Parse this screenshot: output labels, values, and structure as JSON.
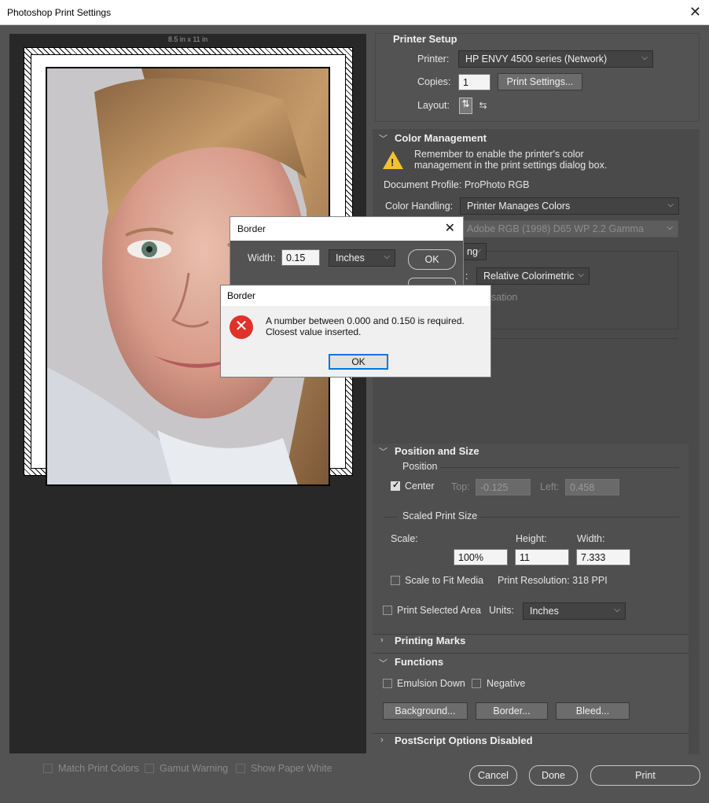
{
  "window": {
    "title": "Photoshop Print Settings",
    "close": "✕"
  },
  "preview": {
    "paper_size": "8.5 in x 11 in"
  },
  "printer_setup": {
    "header": "Printer Setup",
    "printer_label": "Printer:",
    "printer_value": "HP ENVY 4500 series (Network)",
    "copies_label": "Copies:",
    "copies_value": "1",
    "print_settings_button": "Print Settings...",
    "layout_label": "Layout:"
  },
  "color_management": {
    "header": "Color Management",
    "warning_text": "Remember to enable the printer's color management in the print settings dialog box.",
    "document_profile": "Document Profile: ProPhoto RGB",
    "color_handling_label": "Color Handling:",
    "color_handling_value": "Printer Manages Colors",
    "printer_profile_value": "Adobe RGB (1998) D65 WP 2.2 Gamma",
    "proofing_partial": "ng",
    "rendering_intent_partial": ":",
    "rendering_intent_value": "Relative Colorimetric",
    "bpc_partial": "sation"
  },
  "position_size": {
    "header": "Position and Size",
    "position_label": "Position",
    "center_label": "Center",
    "top_label": "Top:",
    "top_value": "-0.125",
    "left_label": "Left:",
    "left_value": "0.458",
    "scaled_label": "Scaled Print Size",
    "scale_label": "Scale:",
    "height_label": "Height:",
    "width_label": "Width:",
    "scale_value": "100%",
    "height_value": "11",
    "width_value": "7.333",
    "fit_media_label": "Scale to Fit Media",
    "print_resolution": "Print Resolution: 318 PPI",
    "print_selected_label": "Print Selected Area",
    "units_label": "Units:",
    "units_value": "Inches"
  },
  "printing_marks": {
    "header": "Printing Marks"
  },
  "functions": {
    "header": "Functions",
    "emulsion_label": "Emulsion Down",
    "negative_label": "Negative",
    "background_button": "Background...",
    "border_button": "Border...",
    "bleed_button": "Bleed..."
  },
  "postscript": {
    "header": "PostScript Options Disabled"
  },
  "bottom": {
    "match_print_colors": "Match Print Colors",
    "gamut_warning": "Gamut Warning",
    "show_paper_white": "Show Paper White",
    "cancel": "Cancel",
    "done": "Done",
    "print": "Print"
  },
  "border_dialog": {
    "title": "Border",
    "width_label": "Width:",
    "width_value": "0.15",
    "units_value": "Inches",
    "ok": "OK"
  },
  "alert_dialog": {
    "title": "Border",
    "message_line1": "A number between 0.000 and 0.150 is required.",
    "message_line2": "Closest value inserted.",
    "ok": "OK"
  }
}
